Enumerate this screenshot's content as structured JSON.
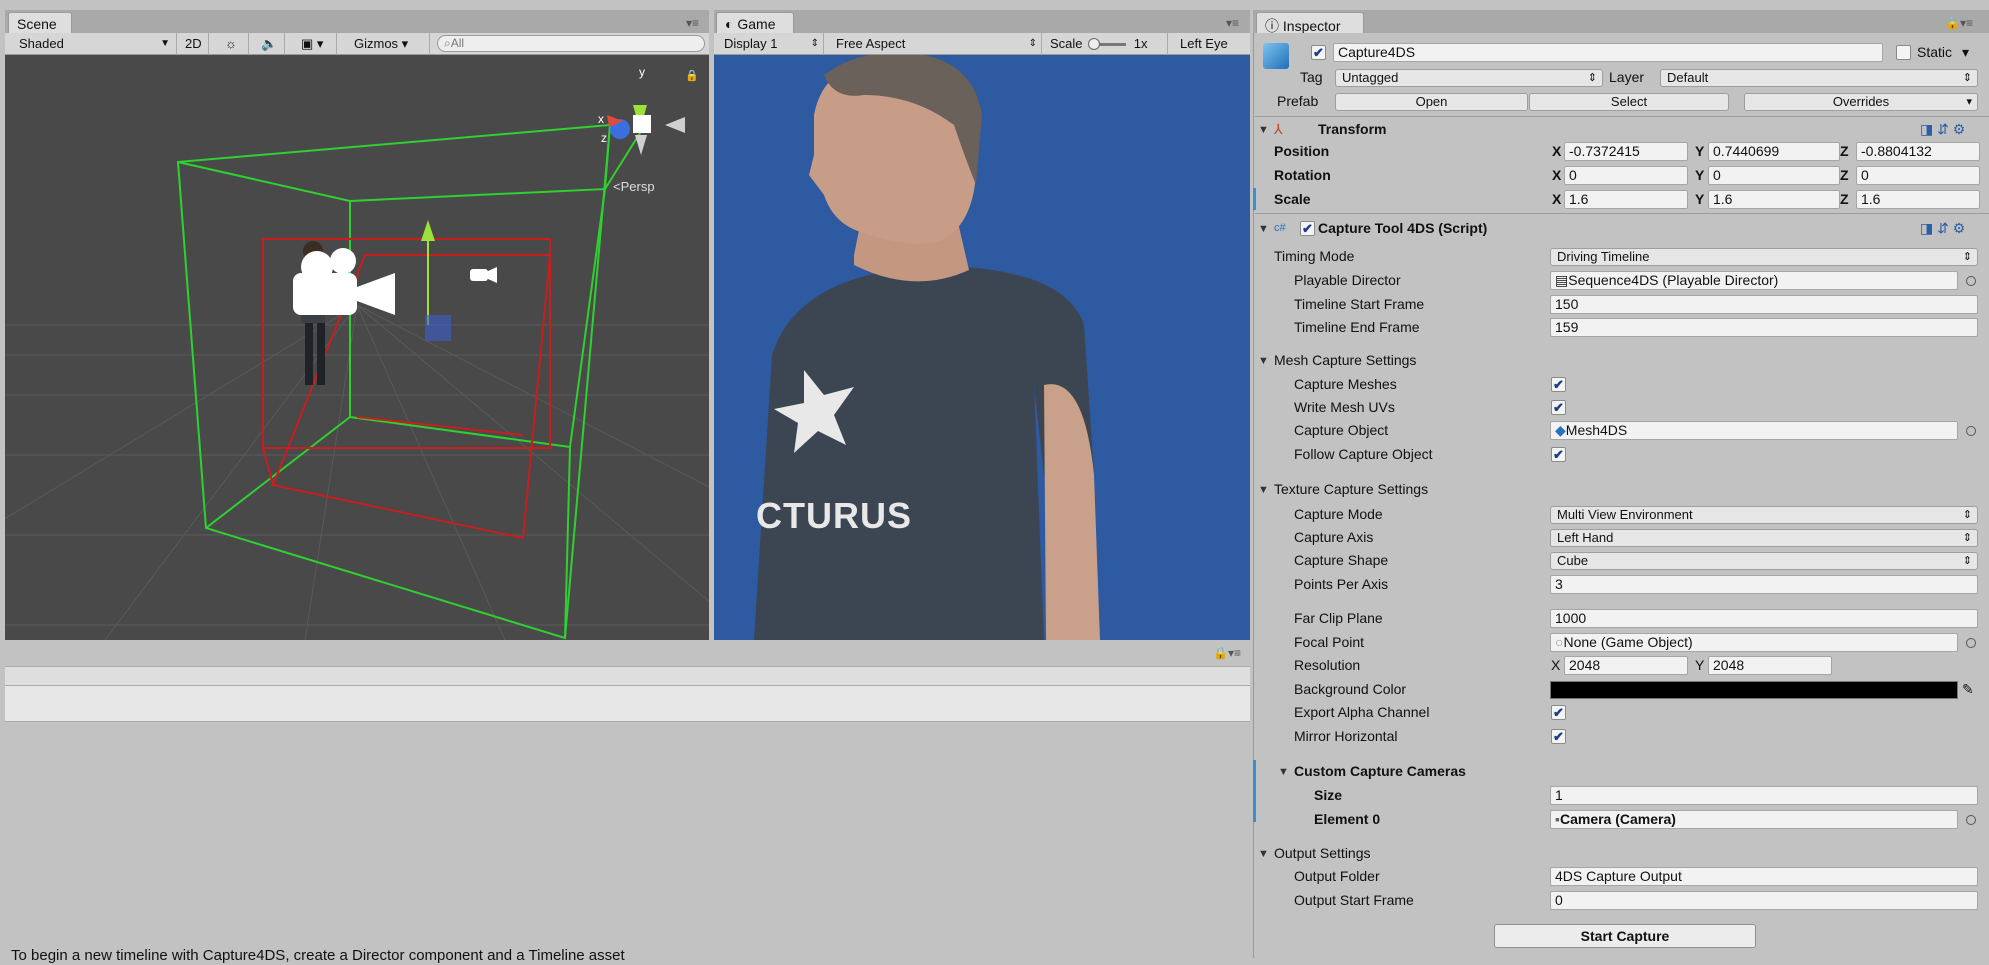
{
  "scene": {
    "tab": "Scene",
    "shading": "Shaded",
    "mode2d": "2D",
    "gizmos": "Gizmos",
    "search_placeholder": "All",
    "persp": "Persp",
    "axis_x": "x",
    "axis_y": "y",
    "axis_z": "z"
  },
  "game": {
    "tab": "Game",
    "display": "Display 1",
    "aspect": "Free Aspect",
    "scale_label": "Scale",
    "scale_value": "1x",
    "eye": "Left Eye",
    "shirt_text": "CTURUS"
  },
  "timeline": {
    "message": "To begin a new timeline with Capture4DS, create a Director component and a Timeline asset"
  },
  "inspector": {
    "tab": "Inspector",
    "object_name": "Capture4DS",
    "static_label": "Static",
    "tag_label": "Tag",
    "tag_value": "Untagged",
    "layer_label": "Layer",
    "layer_value": "Default",
    "prefab_label": "Prefab",
    "prefab_open": "Open",
    "prefab_select": "Select",
    "prefab_overrides": "Overrides",
    "transform": {
      "title": "Transform",
      "position_label": "Position",
      "rotation_label": "Rotation",
      "scale_label": "Scale",
      "pos_x": "-0.7372415",
      "pos_y": "0.7440699",
      "pos_z": "-0.8804132",
      "rot_x": "0",
      "rot_y": "0",
      "rot_z": "0",
      "scl_x": "1.6",
      "scl_y": "1.6",
      "scl_z": "1.6",
      "x": "X",
      "y": "Y",
      "z": "Z"
    },
    "script": {
      "title": "Capture Tool 4DS (Script)",
      "timing_mode_label": "Timing Mode",
      "timing_mode_value": "Driving Timeline",
      "playable_director_label": "Playable Director",
      "playable_director_value": "Sequence4DS (Playable Director)",
      "start_frame_label": "Timeline Start Frame",
      "start_frame_value": "150",
      "end_frame_label": "Timeline End Frame",
      "end_frame_value": "159",
      "mesh_section": "Mesh Capture Settings",
      "capture_meshes_label": "Capture Meshes",
      "write_uvs_label": "Write Mesh UVs",
      "capture_object_label": "Capture Object",
      "capture_object_value": "Mesh4DS",
      "follow_label": "Follow Capture Object",
      "texture_section": "Texture Capture Settings",
      "capture_mode_label": "Capture Mode",
      "capture_mode_value": "Multi View Environment",
      "capture_axis_label": "Capture Axis",
      "capture_axis_value": "Left Hand",
      "capture_shape_label": "Capture Shape",
      "capture_shape_value": "Cube",
      "points_label": "Points Per Axis",
      "points_value": "3",
      "far_clip_label": "Far Clip Plane",
      "far_clip_value": "1000",
      "focal_label": "Focal Point",
      "focal_value": "None (Game Object)",
      "resolution_label": "Resolution",
      "res_x": "2048",
      "res_y": "2048",
      "bg_label": "Background Color",
      "alpha_label": "Export Alpha Channel",
      "mirror_label": "Mirror Horizontal",
      "cameras_section": "Custom Capture Cameras",
      "size_label": "Size",
      "size_value": "1",
      "element_label": "Element 0",
      "element_value": "Camera (Camera)",
      "output_section": "Output Settings",
      "output_folder_label": "Output Folder",
      "output_folder_value": "4DS Capture Output",
      "output_start_label": "Output Start Frame",
      "output_start_value": "0",
      "start_button": "Start Capture"
    }
  },
  "colors": {
    "scene_bg": "#494949",
    "game_bg": "#2d5aa0",
    "bg_color_swatch": "#000000",
    "accent_blue": "#3b8fd6"
  }
}
